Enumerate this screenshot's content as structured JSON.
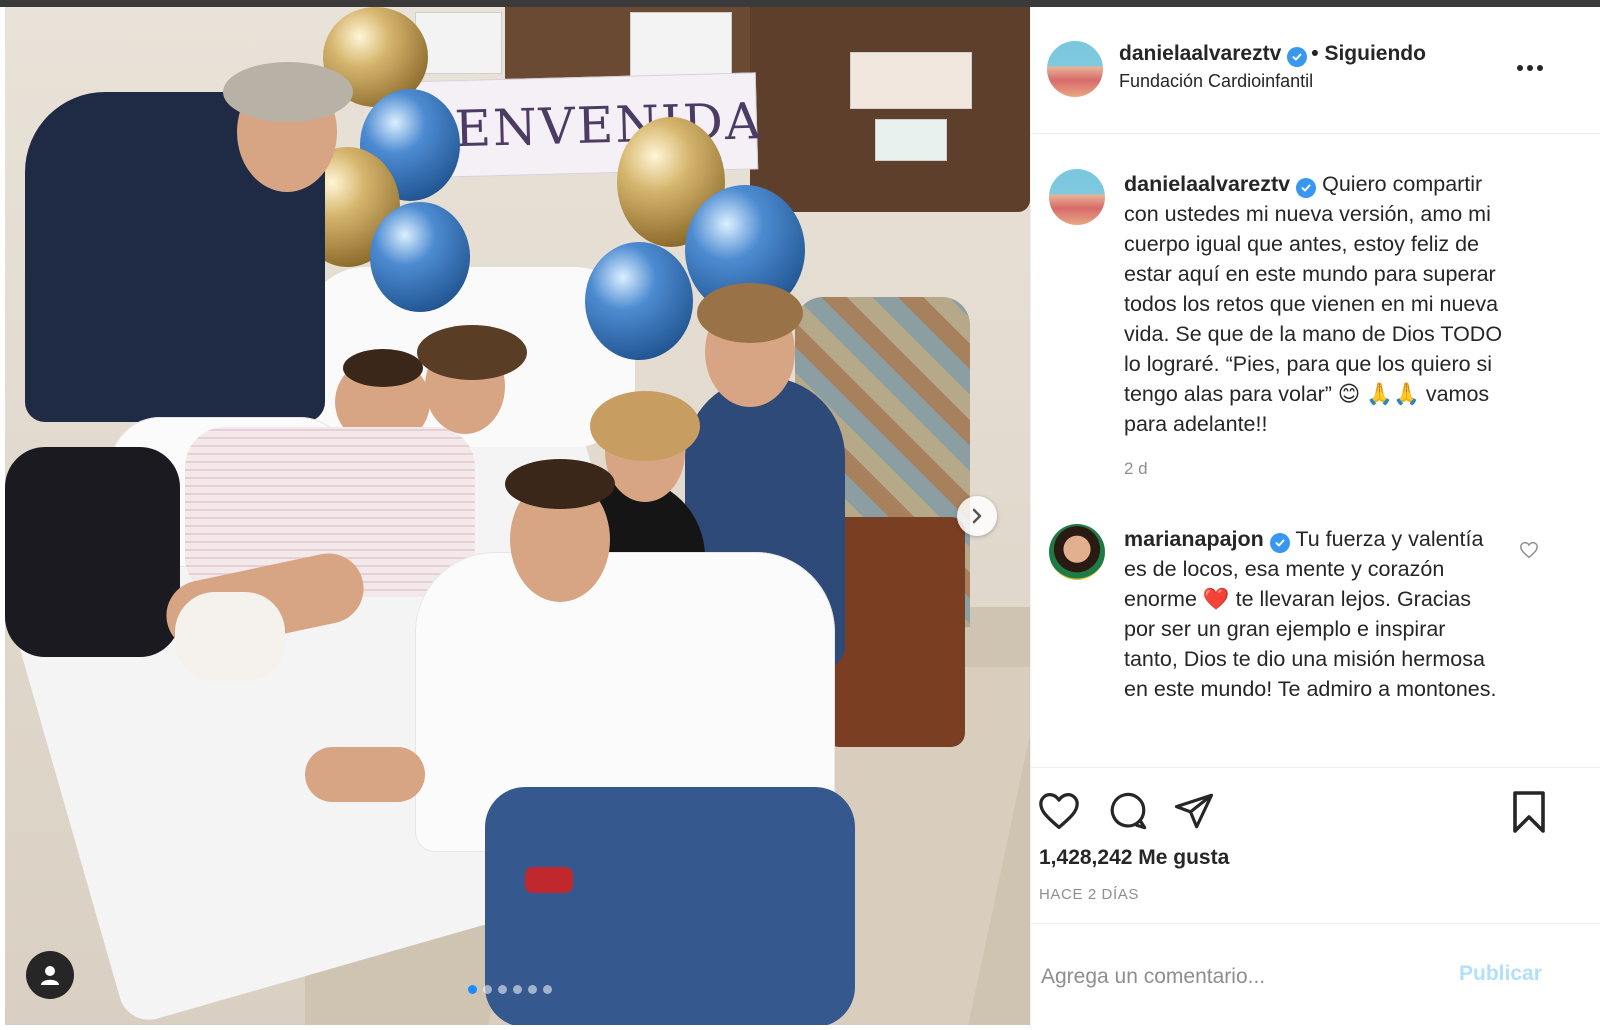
{
  "post": {
    "username": "danielaalvareztv",
    "follow_status": "• Siguiendo",
    "location": "Fundación Cardioinfantil",
    "caption": "Quiero compartir con ustedes mi nueva versión, amo mi cuerpo igual que antes, estoy feliz de estar aquí en este mundo para superar todos los retos que vienen en mi nueva vida. Se que de la mano de Dios TODO lo lograré. “Pies, para que los quiero si tengo alas para volar” 😊 🙏🙏 vamos para adelante!!",
    "caption_time": "2 d",
    "banner_text": "BIENVENIDA"
  },
  "comments": [
    {
      "username": "marianapajon",
      "text": "Tu fuerza y valentía es de locos, esa mente y corazón enorme ❤️ te llevaran lejos. Gracias por ser un gran ejemplo e inspirar tanto, Dios te dio una misión hermosa en este mundo! Te admiro a montones."
    }
  ],
  "stats": {
    "likes": "1,428,242 Me gusta",
    "date": "HACE 2 DÍAS"
  },
  "comment_box": {
    "placeholder": "Agrega un comentario...",
    "publish_label": "Publicar"
  },
  "carousel": {
    "total": 6,
    "active": 1
  },
  "icons": [
    "heart-icon",
    "comment-icon",
    "share-icon",
    "bookmark-icon",
    "more-icon",
    "chevron-right-icon",
    "user-tag-icon",
    "verified-icon"
  ],
  "colors": {
    "verified": "#3897f0",
    "publish": "#b2dffc",
    "muted": "#8e8e8e",
    "text": "#262626"
  }
}
